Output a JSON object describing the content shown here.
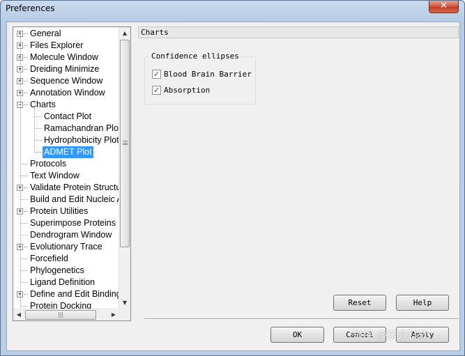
{
  "window": {
    "title": "Preferences",
    "close_glyph": "✕"
  },
  "tree": {
    "items": [
      {
        "label": "General",
        "expander": "+"
      },
      {
        "label": "Files Explorer",
        "expander": "+"
      },
      {
        "label": "Molecule Window",
        "expander": "+"
      },
      {
        "label": "Dreiding Minimize",
        "expander": "+"
      },
      {
        "label": "Sequence Window",
        "expander": "+"
      },
      {
        "label": "Annotation Window",
        "expander": "+"
      },
      {
        "label": "Charts",
        "expander": "−"
      },
      {
        "label": "Contact Plot",
        "expander": ""
      },
      {
        "label": "Ramachandran Plot",
        "expander": ""
      },
      {
        "label": "Hydrophobicity Plot",
        "expander": ""
      },
      {
        "label": "ADMET Plot",
        "expander": ""
      },
      {
        "label": "Protocols",
        "expander": ""
      },
      {
        "label": "Text Window",
        "expander": ""
      },
      {
        "label": "Validate Protein Structure",
        "expander": "+"
      },
      {
        "label": "Build and Edit Nucleic Acid",
        "expander": ""
      },
      {
        "label": "Protein Utilities",
        "expander": "+"
      },
      {
        "label": "Superimpose Proteins",
        "expander": ""
      },
      {
        "label": "Dendrogram Window",
        "expander": ""
      },
      {
        "label": "Evolutionary Trace",
        "expander": "+"
      },
      {
        "label": "Forcefield",
        "expander": ""
      },
      {
        "label": "Phylogenetics",
        "expander": ""
      },
      {
        "label": "Ligand Definition",
        "expander": ""
      },
      {
        "label": "Define and Edit Binding Site",
        "expander": "+"
      },
      {
        "label": "Protein Docking",
        "expander": ""
      }
    ],
    "selected": "ADMET Plot",
    "scroll_up": "▲",
    "scroll_down": "▼",
    "scroll_left": "◀",
    "scroll_right": "▶",
    "hthumb_grip": "|||"
  },
  "page": {
    "header": "Charts",
    "group_title": "Confidence ellipses",
    "checkboxes": [
      {
        "label": "Blood Brain Barrier",
        "checked": true,
        "mark": "✓"
      },
      {
        "label": "Absorption",
        "checked": true,
        "mark": "✓"
      }
    ]
  },
  "buttons": {
    "reset": "Reset",
    "help": "Help",
    "ok": "OK",
    "cancel": "Cancel",
    "apply": "Apply"
  },
  "watermark": "知乎 @东方科软",
  "colors": {
    "selection": "#3399ff",
    "close": "#c23a22",
    "dialog_bg": "#f0f0f0"
  }
}
